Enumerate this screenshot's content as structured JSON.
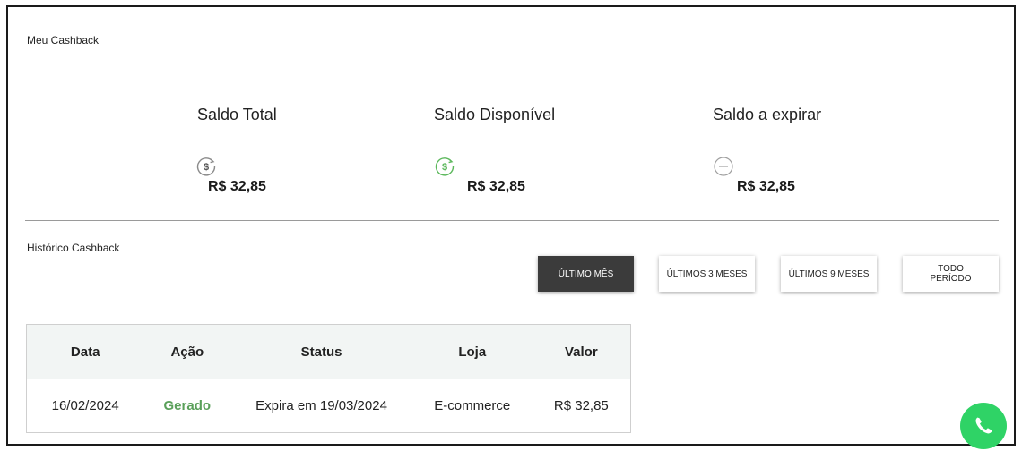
{
  "cashback": {
    "title": "Meu Cashback",
    "balances": [
      {
        "label": "Saldo Total",
        "amount": "R$ 32,85",
        "icon": "dollar-refresh-icon",
        "icon_color": "#8a8a8a"
      },
      {
        "label": "Saldo Disponível",
        "amount": "R$ 32,85",
        "icon": "dollar-refresh-icon",
        "icon_color": "#5cb85c"
      },
      {
        "label": "Saldo a expirar",
        "amount": "R$ 32,85",
        "icon": "minus-circle-icon",
        "icon_color": "#a0a0a0"
      }
    ]
  },
  "history": {
    "title": "Histórico Cashback",
    "filters": [
      {
        "label": "ÚLTIMO MÊS",
        "active": true
      },
      {
        "label": "ÚLTIMOS 3 MESES",
        "active": false
      },
      {
        "label": "ÚLTIMOS 9 MESES",
        "active": false
      },
      {
        "label_line1": "TODO",
        "label_line2": "PERÍODO",
        "active": false
      }
    ],
    "table": {
      "columns": [
        "Data",
        "Ação",
        "Status",
        "Loja",
        "Valor"
      ],
      "rows": [
        {
          "data": "16/02/2024",
          "acao": "Gerado",
          "status": "Expira em 19/03/2024",
          "loja": "E-commerce",
          "valor": "R$ 32,85"
        }
      ]
    }
  },
  "colors": {
    "accent_green": "#5aa05a",
    "active_filter": "#3b3b3b",
    "whatsapp": "#2fd366"
  },
  "whatsapp": {
    "icon": "whatsapp-icon"
  }
}
